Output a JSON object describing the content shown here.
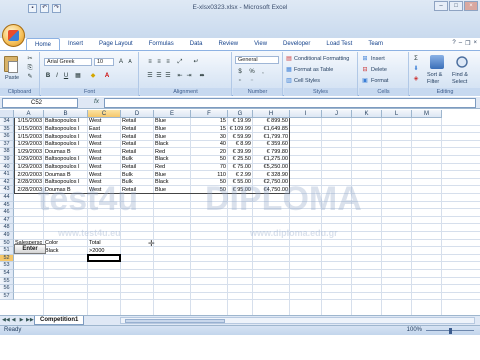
{
  "window": {
    "title": "E-xlsx0323.xlsx - Microsoft Excel",
    "controls": [
      "–",
      "□",
      "×"
    ]
  },
  "tabs": [
    "Home",
    "Insert",
    "Page Layout",
    "Formulas",
    "Data",
    "Review",
    "View",
    "Developer",
    "Load Test",
    "Team"
  ],
  "ribbon": {
    "clipboard": {
      "paste": "Paste",
      "label": "Clipboard"
    },
    "font": {
      "name": "Arial Greek",
      "size": "10",
      "label": "Font"
    },
    "alignment": {
      "label": "Alignment"
    },
    "number": {
      "format": "General",
      "currency": "$",
      "percent": "%",
      "comma": ",",
      "label": "Number"
    },
    "styles": {
      "cond": "Conditional Formatting",
      "table": "Format as Table",
      "cell": "Cell Styles",
      "label": "Styles"
    },
    "cells": {
      "insert": "Insert",
      "delete": "Delete",
      "format": "Format",
      "label": "Cells"
    },
    "editing": {
      "sort": "Sort &",
      "sort2": "Filter",
      "find": "Find &",
      "find2": "Select",
      "label": "Editing"
    }
  },
  "formula_bar": {
    "name_box": "C52",
    "fx": "fx",
    "formula": ""
  },
  "columns": [
    "A",
    "B",
    "C",
    "D",
    "E",
    "F",
    "G",
    "H",
    "I",
    "J",
    "K",
    "L",
    "M"
  ],
  "rows": [
    {
      "num": "34",
      "a": "1/15/2003",
      "b": "Baltsopoulos I",
      "c": "West",
      "d": "Retail",
      "e": "Blue",
      "f": "15",
      "g": "€ 19.99",
      "h": "€ 899.50"
    },
    {
      "num": "35",
      "a": "1/15/2003",
      "b": "Baltsopoulos I",
      "c": "East",
      "d": "Retail",
      "e": "Blue",
      "f": "15",
      "g": "€ 109.99",
      "h": "€1,649.85"
    },
    {
      "num": "36",
      "a": "1/15/2003",
      "b": "Baltsopoulos I",
      "c": "West",
      "d": "Retail",
      "e": "Blue",
      "f": "30",
      "g": "€ 59.99",
      "h": "€1,799.70"
    },
    {
      "num": "37",
      "a": "1/29/2003",
      "b": "Baltsopoulos I",
      "c": "West",
      "d": "Retail",
      "e": "Black",
      "f": "40",
      "g": "€ 8.99",
      "h": "€ 359.60"
    },
    {
      "num": "38",
      "a": "1/29/2003",
      "b": "Doumas B",
      "c": "West",
      "d": "Retail",
      "e": "Red",
      "f": "20",
      "g": "€ 39.99",
      "h": "€ 799.80"
    },
    {
      "num": "39",
      "a": "1/29/2003",
      "b": "Baltsopoulos I",
      "c": "West",
      "d": "Bulk",
      "e": "Black",
      "f": "50",
      "g": "€ 25.50",
      "h": "€1,275.00"
    },
    {
      "num": "40",
      "a": "1/29/2003",
      "b": "Baltsopoulos I",
      "c": "West",
      "d": "Retail",
      "e": "Red",
      "f": "70",
      "g": "€ 75.00",
      "h": "€5,250.00"
    },
    {
      "num": "41",
      "a": "2/20/2003",
      "b": "Doumas B",
      "c": "West",
      "d": "Bulk",
      "e": "Blue",
      "f": "110",
      "g": "€ 2.99",
      "h": "€ 328.90"
    },
    {
      "num": "42",
      "a": "2/28/2003",
      "b": "Baltsopoulos I",
      "c": "West",
      "d": "Bulk",
      "e": "Black",
      "f": "50",
      "g": "€ 55.00",
      "h": "€2,750.00"
    },
    {
      "num": "43",
      "a": "2/28/2003",
      "b": "Doumas B",
      "c": "West",
      "d": "Retail",
      "e": "Blue",
      "f": "50",
      "g": "€ 95.00",
      "h": "€4,750.00"
    },
    {
      "num": "44"
    },
    {
      "num": "45"
    },
    {
      "num": "46"
    },
    {
      "num": "47"
    },
    {
      "num": "48"
    },
    {
      "num": "49"
    },
    {
      "num": "50",
      "a": "Salesperson",
      "b": "Color",
      "c": "Total"
    },
    {
      "num": "51",
      "b": "Black",
      "c": ">2000"
    },
    {
      "num": "52"
    },
    {
      "num": "53"
    },
    {
      "num": "54"
    },
    {
      "num": "55"
    },
    {
      "num": "56"
    },
    {
      "num": "57"
    }
  ],
  "enter_button": "Enter",
  "sheet_tab": "Competition1",
  "status": {
    "ready": "Ready",
    "zoom": "100%"
  },
  "watermark": {
    "brand": "test4u",
    "site1": "www.test4u.eu",
    "site2": "www.diploma.edu.gr",
    "brand2": "DIPLOMA"
  }
}
